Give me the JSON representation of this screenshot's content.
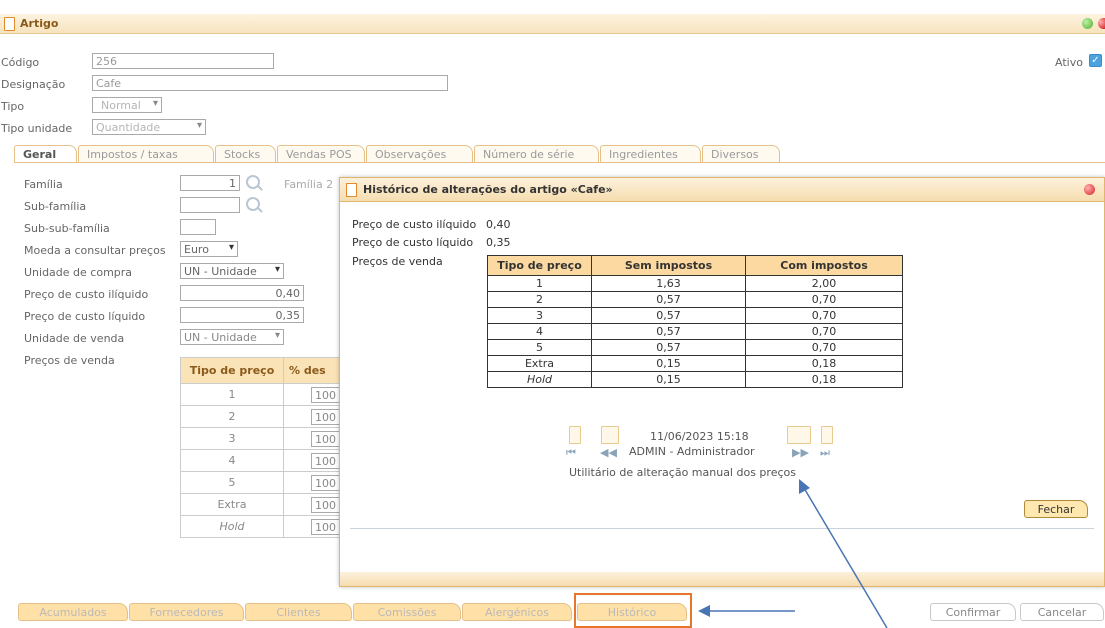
{
  "window": {
    "title": "Artigo"
  },
  "header": {
    "codigo_label": "Código",
    "codigo_value": "256",
    "designacao_label": "Designação",
    "designacao_value": "Cafe",
    "tipo_label": "Tipo",
    "tipo_value": "Normal",
    "tipo_unidade_label": "Tipo unidade",
    "tipo_unidade_value": "Quantidade",
    "ativo_label": "Ativo",
    "ativo_checked": true
  },
  "tabs": [
    {
      "label": "Geral",
      "active": true
    },
    {
      "label": "Impostos / taxas"
    },
    {
      "label": "Stocks"
    },
    {
      "label": "Vendas POS"
    },
    {
      "label": "Observações"
    },
    {
      "label": "Número de série"
    },
    {
      "label": "Ingredientes"
    },
    {
      "label": "Diversos"
    }
  ],
  "geral": {
    "familia_label": "Família",
    "familia_value": "1",
    "familia2_label": "Família 2",
    "subfamilia_label": "Sub-família",
    "subsubfamilia_label": "Sub-sub-família",
    "moeda_label": "Moeda a consultar preços",
    "moeda_value": "Euro",
    "unidade_compra_label": "Unidade de compra",
    "unidade_compra_value": "UN - Unidade",
    "custo_iliquido_label": "Preço de custo ilíquido",
    "custo_iliquido_value": "0,40",
    "custo_liquido_label": "Preço de custo líquido",
    "custo_liquido_value": "0,35",
    "unidade_venda_label": "Unidade de venda",
    "unidade_venda_value": "UN - Unidade",
    "precos_venda_label": "Preços de venda",
    "grid_headers": [
      "Tipo de preço",
      "% des"
    ],
    "grid_rows": [
      {
        "tipo": "1",
        "desc": "100"
      },
      {
        "tipo": "2",
        "desc": "100"
      },
      {
        "tipo": "3",
        "desc": "100"
      },
      {
        "tipo": "4",
        "desc": "100"
      },
      {
        "tipo": "5",
        "desc": "100"
      },
      {
        "tipo": "Extra",
        "desc": "100"
      },
      {
        "tipo": "Hold",
        "desc": "100"
      }
    ]
  },
  "dialog": {
    "title": "Histórico de alterações do artigo «Cafe»",
    "custo_iliquido_label": "Preço de custo ilíquido",
    "custo_iliquido_value": "0,40",
    "custo_liquido_label": "Preço de custo líquido",
    "custo_liquido_value": "0,35",
    "precos_venda_label": "Preços de venda",
    "table_headers": [
      "Tipo de preço",
      "Sem impostos",
      "Com impostos"
    ],
    "table_rows": [
      {
        "tipo": "1",
        "sem": "1,63",
        "com": "2,00"
      },
      {
        "tipo": "2",
        "sem": "0,57",
        "com": "0,70"
      },
      {
        "tipo": "3",
        "sem": "0,57",
        "com": "0,70"
      },
      {
        "tipo": "4",
        "sem": "0,57",
        "com": "0,70"
      },
      {
        "tipo": "5",
        "sem": "0,57",
        "com": "0,70"
      },
      {
        "tipo": "Extra",
        "sem": "0,15",
        "com": "0,18"
      },
      {
        "tipo": "Hold",
        "sem": "0,15",
        "com": "0,18"
      }
    ],
    "nav_datetime": "11/06/2023 15:18",
    "nav_user": "ADMIN - Administrador",
    "nav_source": "Utilitário de alteração manual dos preços",
    "close_label": "Fechar"
  },
  "bottom_buttons": {
    "acumulados": "Acumulados",
    "fornecedores": "Fornecedores",
    "clientes": "Clientes",
    "comissoes": "Comissões",
    "alergenicos": "Alergénicos",
    "historico": "Histórico",
    "confirmar": "Confirmar",
    "cancelar": "Cancelar"
  },
  "colors": {
    "accent": "#e8762a",
    "annotation_arrow": "#4a75b5",
    "header_fill": "#fcd9a0"
  }
}
